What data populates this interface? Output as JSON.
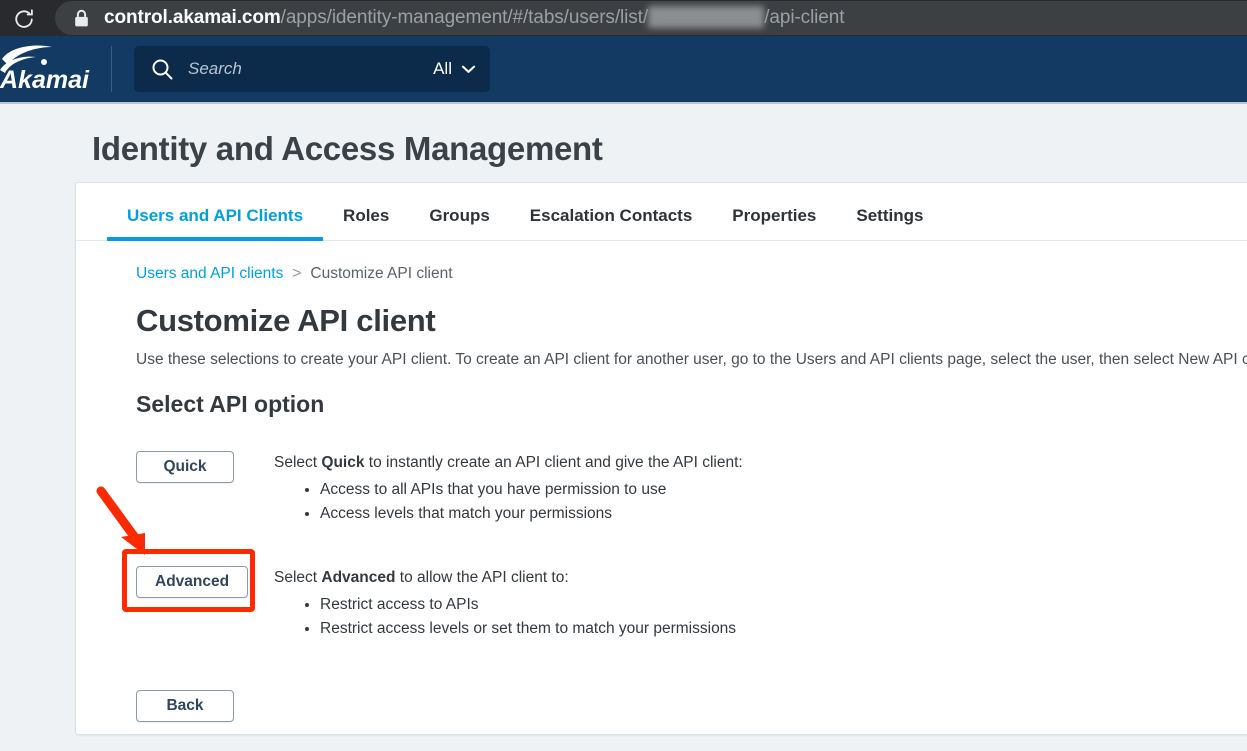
{
  "browser": {
    "reload_icon": "reload-icon",
    "lock_icon": "lock-icon",
    "url_host": "control.akamai.com",
    "url_path_before": "/apps/identity-management/#/tabs/users/list/",
    "url_redacted": "R_F_JDKZP0",
    "url_path_after": "/api-client"
  },
  "topnav": {
    "logo_alt": "Akamai",
    "search_icon": "search-icon",
    "search_value": "",
    "search_placeholder": "Search",
    "scope_label": "All",
    "scope_caret": "chevron-down-icon"
  },
  "page": {
    "title": "Identity and Access Management"
  },
  "tabs": [
    {
      "label": "Users and API Clients",
      "active": true
    },
    {
      "label": "Roles",
      "active": false
    },
    {
      "label": "Groups",
      "active": false
    },
    {
      "label": "Escalation Contacts",
      "active": false
    },
    {
      "label": "Properties",
      "active": false
    },
    {
      "label": "Settings",
      "active": false
    }
  ],
  "breadcrumb": {
    "parent": "Users and API clients",
    "separator": ">",
    "current": "Customize API client"
  },
  "main": {
    "heading": "Customize API client",
    "intro": "Use these selections to create your API client. To create an API client for another user, go to the Users and API clients page, select the user, then select New API client.",
    "section_heading": "Select API option",
    "quick": {
      "button_label": "Quick",
      "lead_prefix": "Select ",
      "lead_bold": "Quick",
      "lead_suffix": " to instantly create an API client and give the API client:",
      "bullets": [
        "Access to all APIs that you have permission to use",
        "Access levels that match your permissions"
      ]
    },
    "advanced": {
      "button_label": "Advanced",
      "lead_prefix": "Select ",
      "lead_bold": "Advanced",
      "lead_suffix": " to allow the API client to:",
      "bullets": [
        "Restrict access to APIs",
        "Restrict access levels or set them to match your permissions"
      ]
    },
    "back_label": "Back"
  },
  "annotation": {
    "highlight_color": "#fc2a00",
    "target": "advanced-button"
  },
  "colors": {
    "nav_background": "#123a63",
    "accent_blue": "#00a0df",
    "page_background": "#eef2f5",
    "card_background": "#ffffff",
    "annotation_red": "#fc2a00"
  }
}
